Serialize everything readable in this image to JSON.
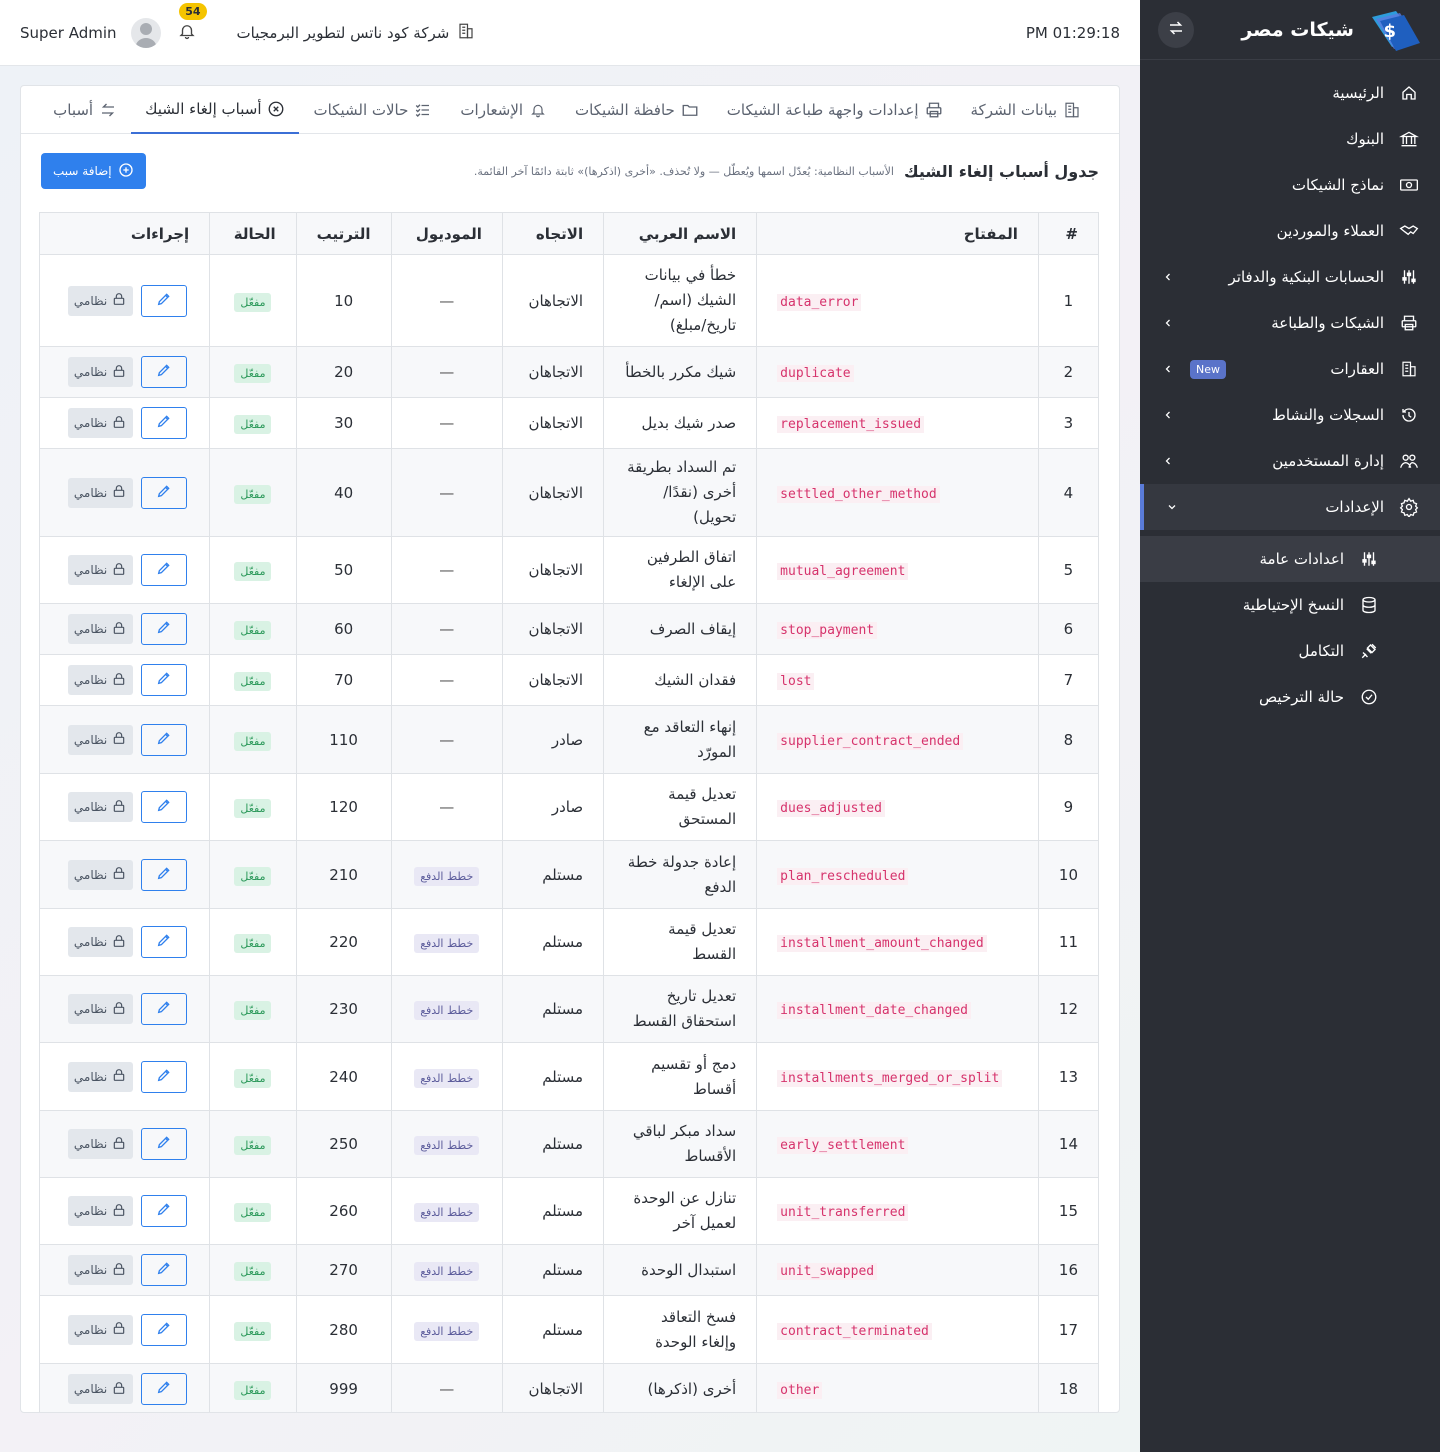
{
  "sidebar": {
    "brand": "شيكات مصر",
    "items": [
      {
        "label": "الرئيسية",
        "icon": "home-icon",
        "chevron": false
      },
      {
        "label": "البنوك",
        "icon": "bank-icon",
        "chevron": false
      },
      {
        "label": "نماذج الشيكات",
        "icon": "banknote-icon",
        "chevron": false
      },
      {
        "label": "العملاء والموردين",
        "icon": "handshake-icon",
        "chevron": false
      },
      {
        "label": "الحسابات البنكية والدفاتر",
        "icon": "sliders-icon",
        "chevron": true
      },
      {
        "label": "الشيكات والطباعة",
        "icon": "printer-icon",
        "chevron": true
      },
      {
        "label": "العقارات",
        "icon": "building-icon",
        "chevron": true,
        "badge": "New"
      },
      {
        "label": "السجلات والنشاط",
        "icon": "history-icon",
        "chevron": true
      },
      {
        "label": "إدارة المستخدمين",
        "icon": "users-icon",
        "chevron": true
      },
      {
        "label": "الإعدادات",
        "icon": "gear-icon",
        "chevron": true,
        "active": true
      }
    ],
    "sub_items": [
      {
        "label": "اعدادات عامة",
        "icon": "sliders-icon",
        "active": true
      },
      {
        "label": "النسخ الإحتياطية",
        "icon": "database-icon"
      },
      {
        "label": "التكامل",
        "icon": "plug-icon"
      },
      {
        "label": "حالة الترخيص",
        "icon": "check-circle-icon"
      }
    ]
  },
  "topbar": {
    "clock": "PM 01:29:18",
    "company": "شركة كود ناتس لتطوير البرمجيات",
    "notifications": "54",
    "user": "Super Admin"
  },
  "tabs": [
    {
      "label": "بيانات الشركة",
      "icon": "building-icon"
    },
    {
      "label": "إعدادات واجهة طباعة الشيكات",
      "icon": "printer-icon"
    },
    {
      "label": "حافظة الشيكات",
      "icon": "folder-icon"
    },
    {
      "label": "الإشعارات",
      "icon": "bell-icon"
    },
    {
      "label": "حالات الشيكات",
      "icon": "list-check-icon"
    },
    {
      "label": "أسباب إلغاء الشيك",
      "icon": "x-circle-icon",
      "active": true
    },
    {
      "label": "أسباب",
      "icon": "return-icon"
    }
  ],
  "card": {
    "title": "جدول أسباب إلغاء الشيك",
    "note": "الأسباب النظامية: يُعدّل اسمها ويُعطّل — ولا تُحذف. «أخرى (اذكرها)» ثابتة دائمًا آخر القائمة.",
    "add_label": "إضافة سبب"
  },
  "table": {
    "headers": [
      "#",
      "المفتاح",
      "الاسم العربي",
      "الاتجاه",
      "الموديول",
      "الترتيب",
      "الحالة",
      "إجراءات"
    ],
    "status_label": "مفعّل",
    "system_label": "نظامي",
    "rows": [
      {
        "n": "1",
        "key": "data_error",
        "name": "خطأ في بيانات الشيك (اسم/تاريخ/مبلغ)",
        "dir": "الاتجاهان",
        "module": "—",
        "order": "10"
      },
      {
        "n": "2",
        "key": "duplicate",
        "name": "شيك مكرر بالخطأ",
        "dir": "الاتجاهان",
        "module": "—",
        "order": "20"
      },
      {
        "n": "3",
        "key": "replacement_issued",
        "name": "صدر شيك بديل",
        "dir": "الاتجاهان",
        "module": "—",
        "order": "30"
      },
      {
        "n": "4",
        "key": "settled_other_method",
        "name": "تم السداد بطريقة أخرى (نقدًا/تحويل)",
        "dir": "الاتجاهان",
        "module": "—",
        "order": "40"
      },
      {
        "n": "5",
        "key": "mutual_agreement",
        "name": "اتفاق الطرفين على الإلغاء",
        "dir": "الاتجاهان",
        "module": "—",
        "order": "50"
      },
      {
        "n": "6",
        "key": "stop_payment",
        "name": "إيقاف الصرف",
        "dir": "الاتجاهان",
        "module": "—",
        "order": "60"
      },
      {
        "n": "7",
        "key": "lost",
        "name": "فقدان الشيك",
        "dir": "الاتجاهان",
        "module": "—",
        "order": "70"
      },
      {
        "n": "8",
        "key": "supplier_contract_ended",
        "name": "إنهاء التعاقد مع المورّد",
        "dir": "صادر",
        "module": "—",
        "order": "110"
      },
      {
        "n": "9",
        "key": "dues_adjusted",
        "name": "تعديل قيمة المستحق",
        "dir": "صادر",
        "module": "—",
        "order": "120"
      },
      {
        "n": "10",
        "key": "plan_rescheduled",
        "name": "إعادة جدولة خطة الدفع",
        "dir": "مستلم",
        "module": "خطط الدفع",
        "order": "210"
      },
      {
        "n": "11",
        "key": "installment_amount_changed",
        "name": "تعديل قيمة القسط",
        "dir": "مستلم",
        "module": "خطط الدفع",
        "order": "220"
      },
      {
        "n": "12",
        "key": "installment_date_changed",
        "name": "تعديل تاريخ استحقاق القسط",
        "dir": "مستلم",
        "module": "خطط الدفع",
        "order": "230"
      },
      {
        "n": "13",
        "key": "installments_merged_or_split",
        "name": "دمج أو تقسيم أقساط",
        "dir": "مستلم",
        "module": "خطط الدفع",
        "order": "240"
      },
      {
        "n": "14",
        "key": "early_settlement",
        "name": "سداد مبكر لباقي الأقساط",
        "dir": "مستلم",
        "module": "خطط الدفع",
        "order": "250"
      },
      {
        "n": "15",
        "key": "unit_transferred",
        "name": "تنازل عن الوحدة لعميل آخر",
        "dir": "مستلم",
        "module": "خطط الدفع",
        "order": "260"
      },
      {
        "n": "16",
        "key": "unit_swapped",
        "name": "استبدال الوحدة",
        "dir": "مستلم",
        "module": "خطط الدفع",
        "order": "270"
      },
      {
        "n": "17",
        "key": "contract_terminated",
        "name": "فسخ التعاقد وإلغاء الوحدة",
        "dir": "مستلم",
        "module": "خطط الدفع",
        "order": "280"
      },
      {
        "n": "18",
        "key": "other",
        "name": "أخرى (اذكرها)",
        "dir": "الاتجاهان",
        "module": "—",
        "order": "999"
      }
    ]
  }
}
